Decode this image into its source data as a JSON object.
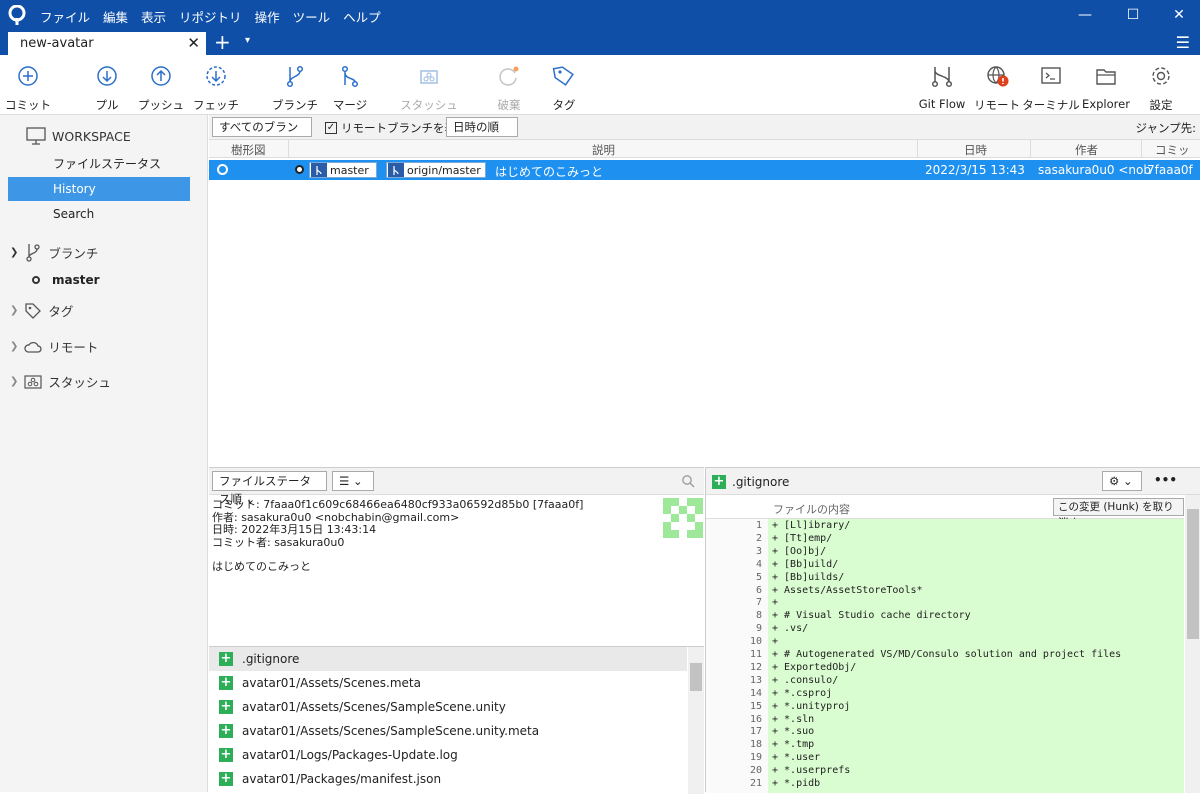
{
  "window": {
    "menus": [
      "ファイル",
      "編集",
      "表示",
      "リポジトリ",
      "操作",
      "ツール",
      "ヘルプ"
    ],
    "minimize": "—",
    "maximize": "☐",
    "close": "✕"
  },
  "tabs": {
    "active_label": "new-avatar",
    "close": "✕",
    "add": "+",
    "more": "▾",
    "menu": "☰"
  },
  "toolbar": {
    "commit": "コミット",
    "pull": "プル",
    "push": "プッシュ",
    "fetch": "フェッチ",
    "branch": "ブランチ",
    "merge": "マージ",
    "stash": "スタッシュ",
    "discard": "破棄",
    "tag": "タグ",
    "gitflow": "Git Flow",
    "remote": "リモート",
    "terminal": "ターミナル",
    "explorer": "Explorer",
    "settings": "設定"
  },
  "sidebar": {
    "workspace": "WORKSPACE",
    "items": [
      "ファイルステータス",
      "History",
      "Search"
    ],
    "branches_label": "ブランチ",
    "current_branch": "master",
    "tags_label": "タグ",
    "remotes_label": "リモート",
    "stash_label": "スタッシュ"
  },
  "filter": {
    "branches": "すべてのブランチ ⌄",
    "show_remote": "リモートブランチを表示",
    "sort": "日時の順 ⌄",
    "jump": "ジャンプ先:"
  },
  "columns": {
    "graph": "樹形図",
    "description": "説明",
    "date": "日時",
    "author": "作者",
    "commit": "コミット"
  },
  "commit": {
    "branch_local": "master",
    "branch_remote": "origin/master",
    "message": "はじめてのこみっと",
    "date": "2022/3/15 13:43",
    "author": "sasakura0u0 <nob",
    "hash": "7faaa0f"
  },
  "details": {
    "sort_label": "ファイルステータス順 ⌄",
    "view_label": "☰ ⌄",
    "line1": "コミット: 7faaa0f1c609c68466ea6480cf933a06592d85b0 [7faaa0f]",
    "line2": "作者: sasakura0u0 <nobchabin@gmail.com>",
    "line3": "日時: 2022年3月15日 13:43:14",
    "line4": "コミット者: sasakura0u0",
    "message": "はじめてのこみっと"
  },
  "files": [
    ".gitignore",
    "avatar01/Assets/Scenes.meta",
    "avatar01/Assets/Scenes/SampleScene.unity",
    "avatar01/Assets/Scenes/SampleScene.unity.meta",
    "avatar01/Logs/Packages-Update.log",
    "avatar01/Packages/manifest.json"
  ],
  "diff": {
    "file_name": ".gitignore",
    "gear": "⚙ ⌄",
    "more": "•••",
    "content_label": "ファイルの内容",
    "hunk_button": "この変更 (Hunk) を取り消す",
    "lines": [
      {
        "n": "1",
        "t": "+ [Ll]ibrary/"
      },
      {
        "n": "2",
        "t": "+ [Tt]emp/"
      },
      {
        "n": "3",
        "t": "+ [Oo]bj/"
      },
      {
        "n": "4",
        "t": "+ [Bb]uild/"
      },
      {
        "n": "5",
        "t": "+ [Bb]uilds/"
      },
      {
        "n": "6",
        "t": "+ Assets/AssetStoreTools*"
      },
      {
        "n": "7",
        "t": "+"
      },
      {
        "n": "8",
        "t": "+ # Visual Studio cache directory"
      },
      {
        "n": "9",
        "t": "+ .vs/"
      },
      {
        "n": "10",
        "t": "+"
      },
      {
        "n": "11",
        "t": "+ # Autogenerated VS/MD/Consulo solution and project files"
      },
      {
        "n": "12",
        "t": "+ ExportedObj/"
      },
      {
        "n": "13",
        "t": "+ .consulo/"
      },
      {
        "n": "14",
        "t": "+ *.csproj"
      },
      {
        "n": "15",
        "t": "+ *.unityproj"
      },
      {
        "n": "16",
        "t": "+ *.sln"
      },
      {
        "n": "17",
        "t": "+ *.suo"
      },
      {
        "n": "18",
        "t": "+ *.tmp"
      },
      {
        "n": "19",
        "t": "+ *.user"
      },
      {
        "n": "20",
        "t": "+ *.userprefs"
      },
      {
        "n": "21",
        "t": "+ *.pidb"
      }
    ]
  },
  "colors": {
    "titlebar": "#0f4fa8",
    "selection": "#1e90f0",
    "added": "#2fae5a",
    "diffbg": "#d9fcd0"
  }
}
